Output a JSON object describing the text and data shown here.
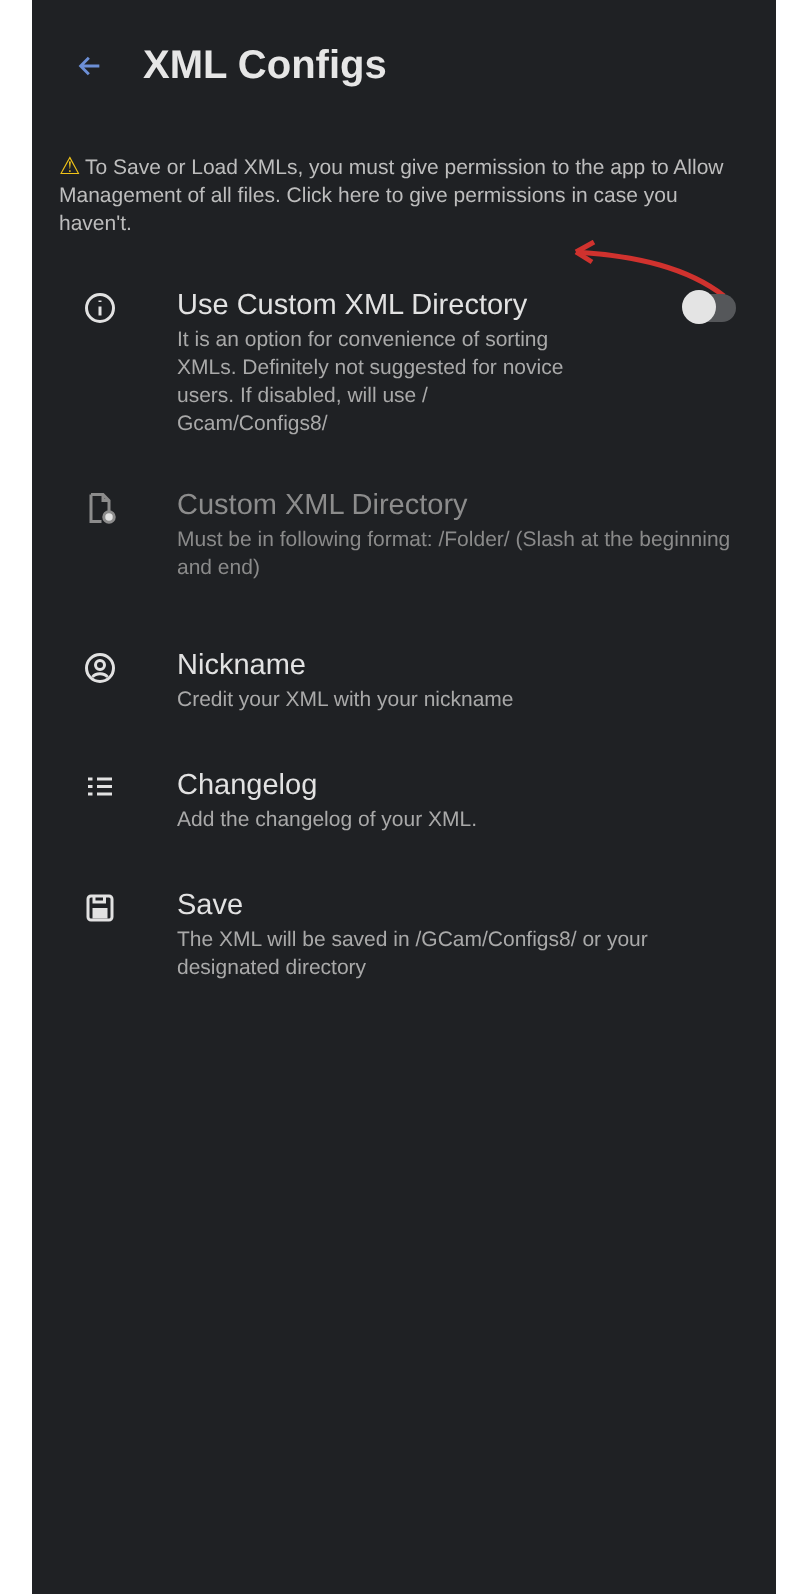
{
  "app_bar": {
    "title": "XML Configs"
  },
  "notice": {
    "icon": "⚠",
    "text": "To Save or Load XMLs, you must give permission to the app to Allow Management of all files. Click here to give permissions in case you haven't."
  },
  "settings": [
    {
      "kind": "toggle",
      "title": "Use Custom XML Directory",
      "summary": "It is an option for convenience of sorting XMLs. Definitely not suggested for novice users. If disabled, will use / Gcam/Configs8/",
      "on": false,
      "disabled": false
    },
    {
      "kind": "plain",
      "title": "Custom XML Directory",
      "summary": "Must be in following format: /Folder/ (Slash at the beginning and end)",
      "disabled": true
    },
    {
      "kind": "plain",
      "title": "Nickname",
      "summary": "Credit your XML with your nickname",
      "disabled": false
    },
    {
      "kind": "plain",
      "title": "Changelog",
      "summary": "Add the changelog of your XML.",
      "disabled": false
    },
    {
      "kind": "plain",
      "title": "Save",
      "summary": "The XML will be saved in /GCam/Configs8/ or your designated directory",
      "disabled": false
    }
  ]
}
